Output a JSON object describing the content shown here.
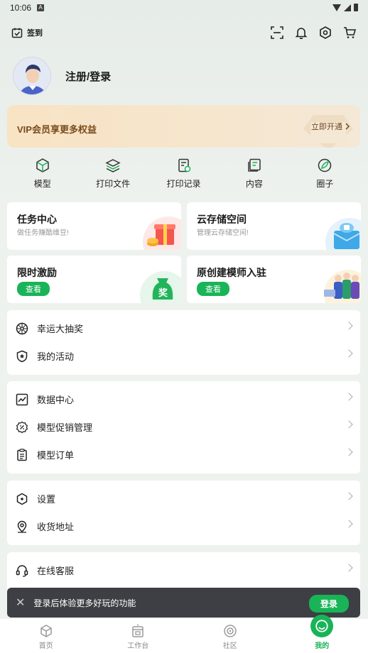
{
  "status": {
    "time": "10:06",
    "sim": "A"
  },
  "top": {
    "checkin": "签到"
  },
  "profile": {
    "login": "注册/登录"
  },
  "vip": {
    "text": "VIP会员享更多权益",
    "button": "立即开通"
  },
  "quick": [
    {
      "label": "模型",
      "icon": "cube-icon"
    },
    {
      "label": "打印文件",
      "icon": "layers-icon"
    },
    {
      "label": "打印记录",
      "icon": "print-record-icon"
    },
    {
      "label": "内容",
      "icon": "content-icon"
    },
    {
      "label": "圈子",
      "icon": "leaf-icon"
    }
  ],
  "cards": {
    "task": {
      "title": "任务中心",
      "sub": "做任务赚酷维豆!"
    },
    "cloud": {
      "title": "云存储空间",
      "sub": "管理云存储空间!"
    },
    "incentive": {
      "title": "限时激励",
      "button": "查看",
      "badge": "奖"
    },
    "creator": {
      "title": "原创建模师入驻",
      "button": "查看"
    }
  },
  "list1": [
    {
      "label": "幸运大抽奖",
      "icon": "wheel-icon"
    },
    {
      "label": "我的活动",
      "icon": "shield-star-icon"
    }
  ],
  "list2": [
    {
      "label": "数据中心",
      "icon": "chart-icon"
    },
    {
      "label": "模型促销管理",
      "icon": "discount-icon"
    },
    {
      "label": "模型订单",
      "icon": "order-icon"
    }
  ],
  "list3": [
    {
      "label": "设置",
      "icon": "settings-icon"
    },
    {
      "label": "收货地址",
      "icon": "location-icon"
    }
  ],
  "list4": [
    {
      "label": "在线客服",
      "icon": "headset-icon"
    }
  ],
  "toast": {
    "text": "登录后体验更多好玩的功能",
    "button": "登录"
  },
  "tabs": [
    {
      "label": "首页",
      "icon": "home-cube-icon"
    },
    {
      "label": "工作台",
      "icon": "printer-icon"
    },
    {
      "label": "社区",
      "icon": "community-icon"
    },
    {
      "label": "我的",
      "icon": "me-icon"
    }
  ],
  "colors": {
    "accent": "#19b457",
    "vip_text": "#7a4c1c",
    "toast_bg": "#3d3f44"
  }
}
